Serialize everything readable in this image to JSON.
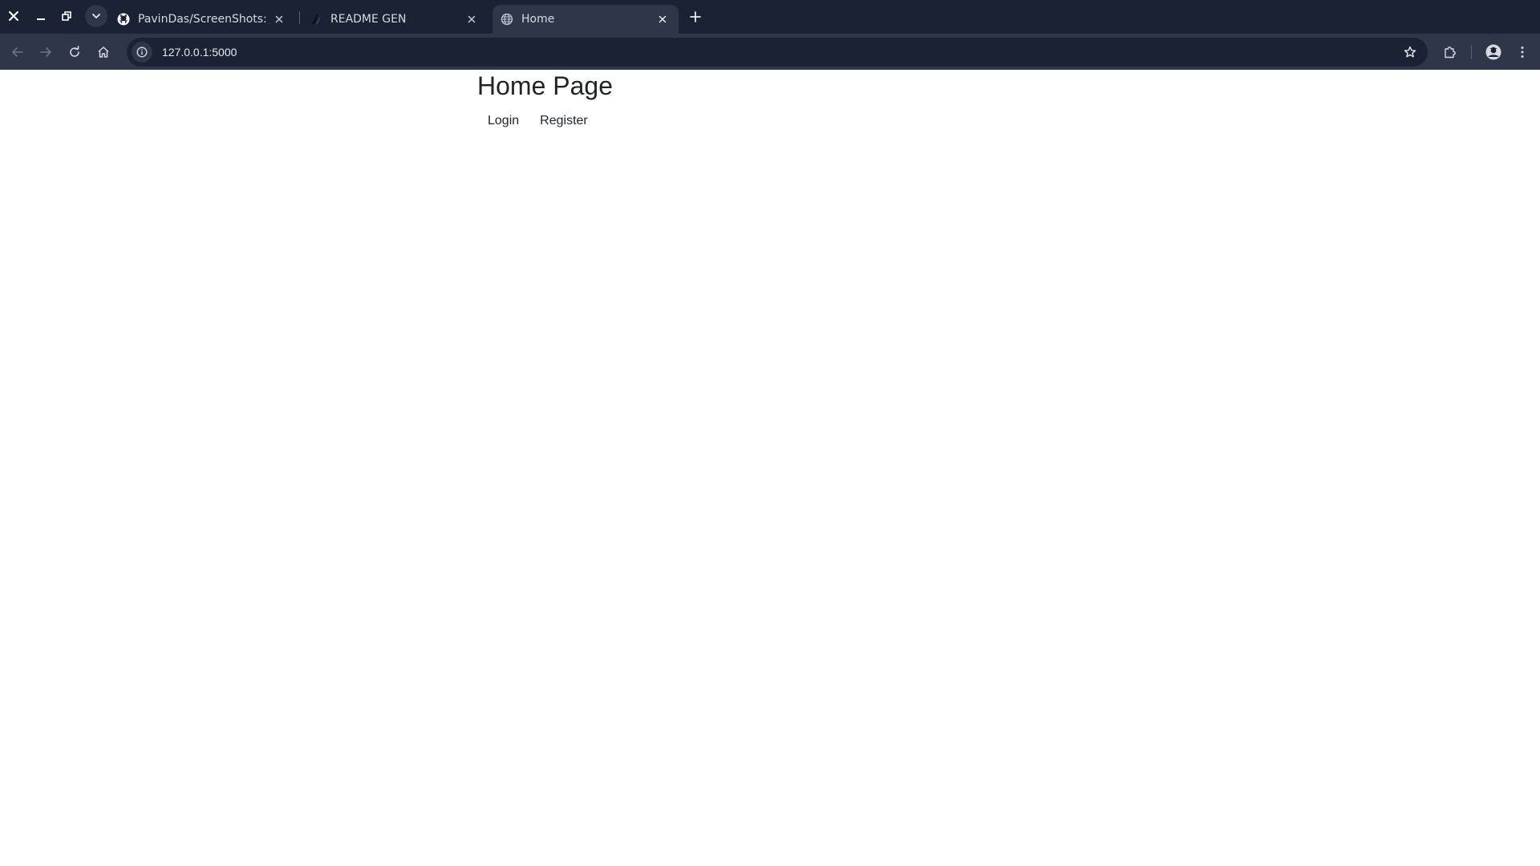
{
  "browser": {
    "tabs": [
      {
        "title": "PavinDas/ScreenShots: My",
        "favicon": "github-icon",
        "active": false
      },
      {
        "title": "README GEN",
        "favicon": "readme-gen-icon",
        "active": false
      },
      {
        "title": "Home",
        "favicon": "globe-icon",
        "active": true
      }
    ],
    "address": "127.0.0.1:5000",
    "icons": {
      "close": "close-icon",
      "minimize": "minimize-icon",
      "restore": "restore-icon",
      "tab_search": "chevron-down-icon",
      "new_tab": "plus-icon",
      "back": "arrow-left-icon",
      "forward": "arrow-right-icon",
      "reload": "reload-icon",
      "home": "home-icon",
      "site_info": "info-icon",
      "bookmark": "star-icon",
      "extensions": "puzzle-icon",
      "profile": "avatar-icon",
      "menu": "kebab-menu-icon"
    },
    "colors": {
      "tabstrip": "#1b2233",
      "toolbar": "#2f3649",
      "omnibox": "#1b2233"
    }
  },
  "page": {
    "title": "Home Page",
    "nav": {
      "login": "Login",
      "register": "Register"
    }
  }
}
